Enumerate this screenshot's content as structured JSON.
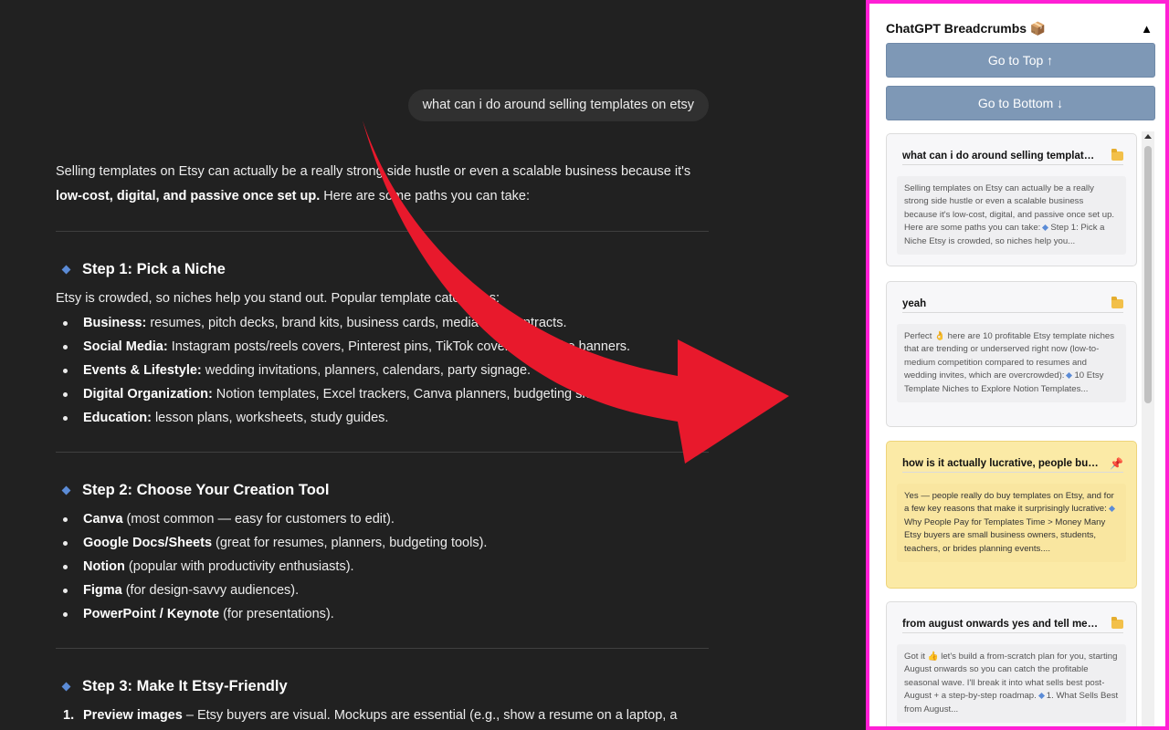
{
  "chat": {
    "user_message": "what can i do around selling templates on etsy",
    "intro_part1": "Selling templates on Etsy can actually be a really strong side hustle or even a scalable business because it's",
    "intro_bold": "low-cost, digital, and passive once set up.",
    "intro_part2": " Here are some paths you can take:",
    "step1": {
      "title": "Step 1: Pick a Niche",
      "lead": "Etsy is crowded, so niches help you stand out. Popular template categories:",
      "items": [
        {
          "bold": "Business:",
          "text": " resumes, pitch decks, brand kits, business cards, media kits, contracts."
        },
        {
          "bold": "Social Media:",
          "text": " Instagram posts/reels covers, Pinterest pins, TikTok covers, YouTube banners."
        },
        {
          "bold": "Events & Lifestyle:",
          "text": " wedding invitations, planners, calendars, party signage."
        },
        {
          "bold": "Digital Organization:",
          "text": " Notion templates, Excel trackers, Canva planners, budgeting sheets."
        },
        {
          "bold": "Education:",
          "text": " lesson plans, worksheets, study guides."
        }
      ]
    },
    "step2": {
      "title": "Step 2: Choose Your Creation Tool",
      "items": [
        {
          "bold": "Canva",
          "text": " (most common — easy for customers to edit)."
        },
        {
          "bold": "Google Docs/Sheets",
          "text": " (great for resumes, planners, budgeting tools)."
        },
        {
          "bold": "Notion",
          "text": " (popular with productivity enthusiasts)."
        },
        {
          "bold": "Figma",
          "text": " (for design-savvy audiences)."
        },
        {
          "bold": "PowerPoint / Keynote",
          "text": " (for presentations)."
        }
      ]
    },
    "step3": {
      "title": "Step 3: Make It Etsy-Friendly",
      "items": [
        {
          "num": "1.",
          "bold": "Preview images",
          "text": " – Etsy buyers are visual. Mockups are essential (e.g., show a resume on a laptop, a"
        }
      ]
    }
  },
  "sidebar": {
    "title": "ChatGPT Breadcrumbs 📦",
    "collapse_glyph": "▲",
    "go_top": "Go to Top ↑",
    "go_bottom": "Go to Bottom ↓",
    "cards": [
      {
        "title": "what can i do around selling template…",
        "icon": "folder-icon",
        "pinned": false,
        "body_a": "Selling templates on Etsy can actually be a really strong side hustle or even a scalable business because it's low-cost, digital, and passive once set up. Here are some paths you can take:",
        "body_b": "Step 1: Pick a Niche Etsy is crowded, so niches help you..."
      },
      {
        "title": "yeah",
        "icon": "folder-icon",
        "pinned": false,
        "body_a": "Perfect 👌 here are 10 profitable Etsy template niches that are trending or underserved right now (low-to-medium competition compared to resumes and wedding invites, which are overcrowded):",
        "body_b": "10 Etsy Template Niches to Explore Notion Templates..."
      },
      {
        "title": "how is it actually lucrative, people bu…",
        "icon": "pin-icon",
        "pinned": true,
        "body_a": "Yes — people really do buy templates on Etsy, and for a few key reasons that make it surprisingly lucrative:",
        "body_b": "Why People Pay for Templates Time > Money Many Etsy buyers are small business owners, students, teachers, or brides planning events...."
      },
      {
        "title": "from august onwards yes and tell me …",
        "icon": "folder-icon",
        "pinned": false,
        "body_a": "Got it 👍 let's build a from-scratch plan for you, starting August onwards so you can catch the profitable seasonal wave. I'll break it into what sells best post-August + a step-by-step roadmap.",
        "body_b": "1. What Sells Best from August..."
      }
    ]
  },
  "colors": {
    "accent_border": "#ff1fd5",
    "arrow": "#e8192c",
    "pinned_card": "#fbeaa6",
    "nav_button": "#7e98b6"
  }
}
